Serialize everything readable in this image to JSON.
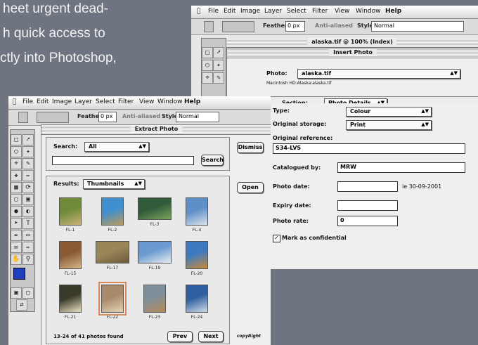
{
  "article_text": {
    "lines": [
      "heet urgent dead-",
      "h quick access to",
      "ctly into Photoshop,"
    ]
  },
  "back_window": {
    "menu": [
      "File",
      "Edit",
      "Image",
      "Layer",
      "Select",
      "Filter",
      "View",
      "Window",
      "Help"
    ],
    "options": {
      "feather_label": "Feather:",
      "feather_value": "0 px",
      "anti_aliased": "Anti-aliased",
      "style_label": "Style:",
      "style_value": "Normal"
    },
    "document_title": "alaska.tif @ 100% (Index)",
    "dialog_title": "Insert Photo",
    "photo_label": "Photo:",
    "photo_value": "alaska.tif",
    "path_text": "Macintosh HD:Alaska:alaska.tif",
    "section_label": "Section:",
    "section_value": "Photo Details",
    "fields": {
      "type_label": "Type:",
      "type_value": "Colour",
      "storage_label": "Original storage:",
      "storage_value": "Print",
      "reference_label": "Original reference:",
      "reference_value": "S34-LVS",
      "catalogued_label": "Catalogued by:",
      "catalogued_value": "MRW",
      "photo_date_label": "Photo date:",
      "photo_date_hint": "ie 30-09-2001",
      "expiry_label": "Expiry date:",
      "rate_label": "Photo rate:",
      "rate_value": "0",
      "confidential_label": "Mark as confidential"
    }
  },
  "front_window": {
    "menu": [
      "File",
      "Edit",
      "Image",
      "Layer",
      "Select",
      "Filter",
      "View",
      "Window",
      "Help"
    ],
    "options": {
      "feather_label": "Feather:",
      "feather_value": "0 px",
      "anti_aliased": "Anti-aliased",
      "style_label": "Style:",
      "style_value": "Normal"
    },
    "dialog_title": "Extract Photo",
    "search_label": "Search:",
    "search_value": "All",
    "search_button": "Search",
    "dismiss_button": "Dismiss",
    "open_button": "Open",
    "results_label": "Results:",
    "results_value": "Thumbnails",
    "thumbnails": [
      {
        "caption": "FL-1",
        "colors": [
          "#6f8b3a",
          "#c9b27a"
        ]
      },
      {
        "caption": "FL-2",
        "colors": [
          "#3f8fd0",
          "#b99a5c"
        ]
      },
      {
        "caption": "FL-3",
        "colors": [
          "#2f5b3a",
          "#7da35d"
        ]
      },
      {
        "caption": "FL-4",
        "colors": [
          "#5f8fc8",
          "#d9e3ea"
        ]
      },
      {
        "caption": "FL-15",
        "colors": [
          "#8a5a35",
          "#d5b58a"
        ]
      },
      {
        "caption": "FL-17",
        "colors": [
          "#9a8658",
          "#6a5a3a"
        ]
      },
      {
        "caption": "FL-19",
        "colors": [
          "#6b9ad0",
          "#e8eef2"
        ]
      },
      {
        "caption": "FL-20",
        "colors": [
          "#3f7ac0",
          "#c78a3a"
        ]
      },
      {
        "caption": "FL-21",
        "colors": [
          "#3a3a2a",
          "#e8e0c0"
        ]
      },
      {
        "caption": "FL-22",
        "colors": [
          "#a88a6a",
          "#e6d2b5"
        ]
      },
      {
        "caption": "FL-23",
        "colors": [
          "#7f8f9a",
          "#b58a5a"
        ]
      },
      {
        "caption": "FL-24",
        "colors": [
          "#2f5fa0",
          "#d0dce8"
        ]
      }
    ],
    "status_text": "13-24 of 41 photos found",
    "prev_button": "Prev",
    "next_button": "Next",
    "brand_text": "copyRight"
  }
}
